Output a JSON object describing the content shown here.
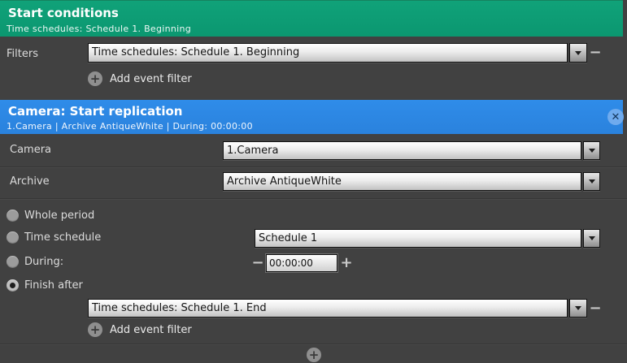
{
  "colors": {
    "background": "#414141",
    "green_header": "#0d9e75",
    "blue_header": "#2c87e3",
    "field_text": "#141414"
  },
  "icons": {
    "plus": "+",
    "minus": "−",
    "close": "✕"
  },
  "start_conditions": {
    "title": "Start conditions",
    "subtitle": "Time schedules: Schedule 1. Beginning",
    "filters_label": "Filters",
    "filter_value": "Time schedules: Schedule 1. Beginning",
    "add_event_filter_label": "Add event filter"
  },
  "action": {
    "title": "Camera: Start replication",
    "subtitle": "1.Camera | Archive AntiqueWhite | During: 00:00:00",
    "camera": {
      "label": "Camera",
      "value": "1.Camera"
    },
    "archive": {
      "label": "Archive",
      "value": "Archive AntiqueWhite"
    },
    "options": {
      "whole_period": {
        "label": "Whole period",
        "selected": false
      },
      "time_schedule": {
        "label": "Time schedule",
        "selected": false,
        "value": "Schedule 1"
      },
      "during": {
        "label": "During:",
        "selected": false,
        "value": "00:00:00"
      },
      "finish_after": {
        "label": "Finish after",
        "selected": true,
        "value": "Time schedules: Schedule 1. End"
      }
    },
    "add_event_filter_label": "Add event filter"
  }
}
